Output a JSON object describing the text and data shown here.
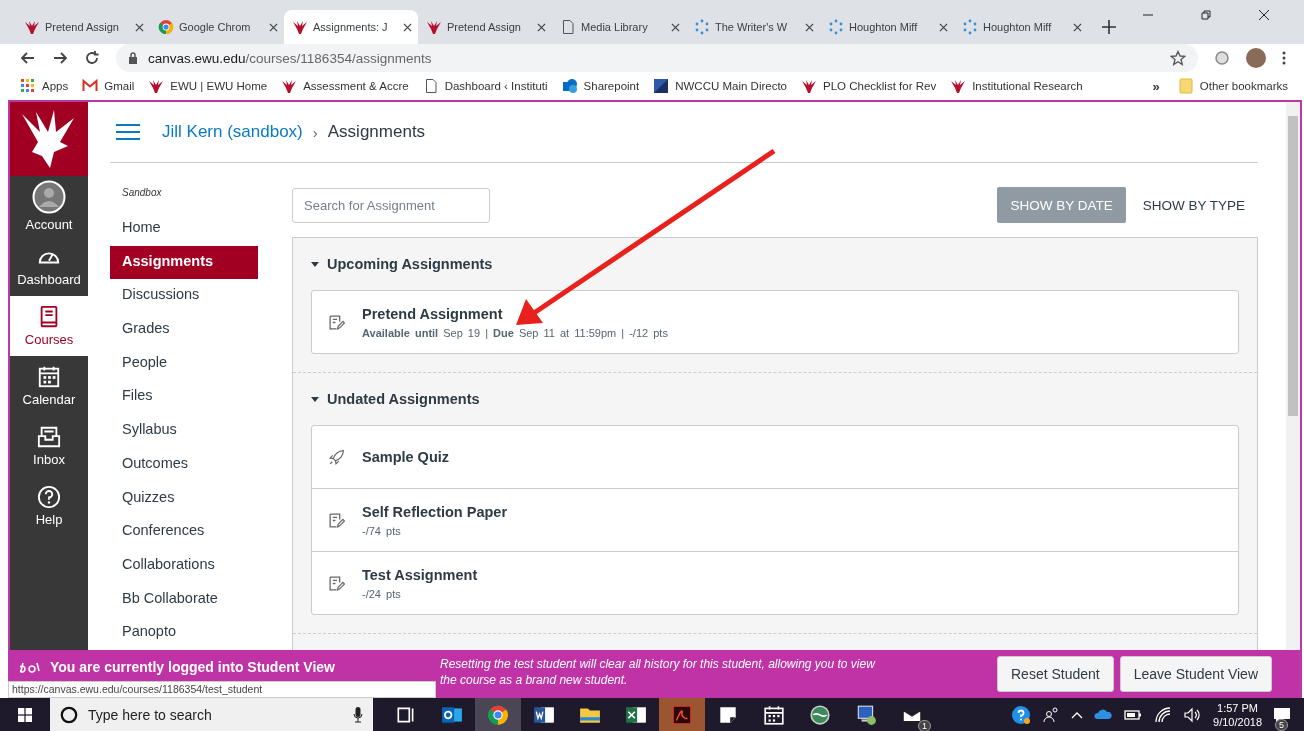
{
  "browser": {
    "tabs": [
      {
        "title": "Pretend Assign",
        "kind": "bird",
        "selected": false
      },
      {
        "title": "Google Chrom",
        "kind": "chrome",
        "selected": false
      },
      {
        "title": "Assignments: J",
        "kind": "bird",
        "selected": true
      },
      {
        "title": "Pretend Assign",
        "kind": "bird",
        "selected": false
      },
      {
        "title": "Media Library",
        "kind": "page",
        "selected": false
      },
      {
        "title": "The Writer's W",
        "kind": "spinner",
        "selected": false
      },
      {
        "title": "Houghton Miff",
        "kind": "spinner",
        "selected": false
      },
      {
        "title": "Houghton Miff",
        "kind": "spinner",
        "selected": false
      }
    ],
    "address": {
      "host": "canvas.ewu.edu",
      "path": "/courses/1186354/assignments"
    },
    "bookmarks": [
      {
        "label": "Apps",
        "kind": "apps"
      },
      {
        "label": "Gmail",
        "kind": "gmail"
      },
      {
        "label": "EWU | EWU Home",
        "kind": "bird"
      },
      {
        "label": "Assessment & Accre",
        "kind": "bird"
      },
      {
        "label": "Dashboard ‹ Instituti",
        "kind": "page"
      },
      {
        "label": "Sharepoint",
        "kind": "sharepoint"
      },
      {
        "label": "NWCCU Main Directo",
        "kind": "square"
      },
      {
        "label": "PLO Checklist for Rev",
        "kind": "bird"
      },
      {
        "label": "Institutional Research",
        "kind": "bird"
      }
    ],
    "more": "»",
    "other_bookmarks": "Other bookmarks"
  },
  "global_nav": [
    {
      "label": "Account",
      "kind": "avatar",
      "selected": false
    },
    {
      "label": "Dashboard",
      "kind": "gauge",
      "selected": false
    },
    {
      "label": "Courses",
      "kind": "book",
      "selected": true
    },
    {
      "label": "Calendar",
      "kind": "calendar",
      "selected": false
    },
    {
      "label": "Inbox",
      "kind": "inbox",
      "selected": false
    },
    {
      "label": "Help",
      "kind": "help",
      "selected": false
    }
  ],
  "breadcrumb": {
    "course": "Jill Kern (sandbox)",
    "separator": "›",
    "page": "Assignments"
  },
  "course_label": "Sandbox",
  "course_nav": [
    {
      "label": "Home",
      "selected": false
    },
    {
      "label": "Assignments",
      "selected": true
    },
    {
      "label": "Discussions",
      "selected": false
    },
    {
      "label": "Grades",
      "selected": false
    },
    {
      "label": "People",
      "selected": false
    },
    {
      "label": "Files",
      "selected": false
    },
    {
      "label": "Syllabus",
      "selected": false
    },
    {
      "label": "Outcomes",
      "selected": false
    },
    {
      "label": "Quizzes",
      "selected": false
    },
    {
      "label": "Conferences",
      "selected": false
    },
    {
      "label": "Collaborations",
      "selected": false
    },
    {
      "label": "Bb Collaborate",
      "selected": false
    },
    {
      "label": "Panopto",
      "selected": false
    }
  ],
  "search": {
    "placeholder": "Search for Assignment"
  },
  "view_buttons": [
    {
      "label": "SHOW BY DATE",
      "selected": true
    },
    {
      "label": "SHOW BY TYPE",
      "selected": false
    }
  ],
  "groups": [
    {
      "title": "Upcoming Assignments",
      "expanded": true,
      "assignments": [
        {
          "title": "Pretend Assignment",
          "kind": "assignment",
          "meta": "**Available until** Sep 19 | **Due** Sep 11 at 11:59pm | -/12 pts"
        }
      ]
    },
    {
      "title": "Undated Assignments",
      "expanded": true,
      "assignments": [
        {
          "title": "Sample Quiz",
          "kind": "quiz"
        },
        {
          "title": "Self Reflection Paper",
          "kind": "assignment",
          "meta": "-/74 pts"
        },
        {
          "title": "Test Assignment",
          "kind": "assignment",
          "meta": "-/24 pts"
        }
      ]
    }
  ],
  "student_view": {
    "message": "You are currently logged into Student View",
    "note": "Resetting the test student will clear all history for this student, allowing you to view the course as a brand new student.",
    "buttons": [
      "Reset Student",
      "Leave Student View"
    ]
  },
  "status_url": "https://canvas.ewu.edu/courses/1186354/test_student",
  "taskbar": {
    "search": {
      "placeholder": "Type here to search"
    },
    "mail_badge": "1",
    "time": "1:57 PM",
    "date": "9/10/2018",
    "notifications": "5"
  }
}
